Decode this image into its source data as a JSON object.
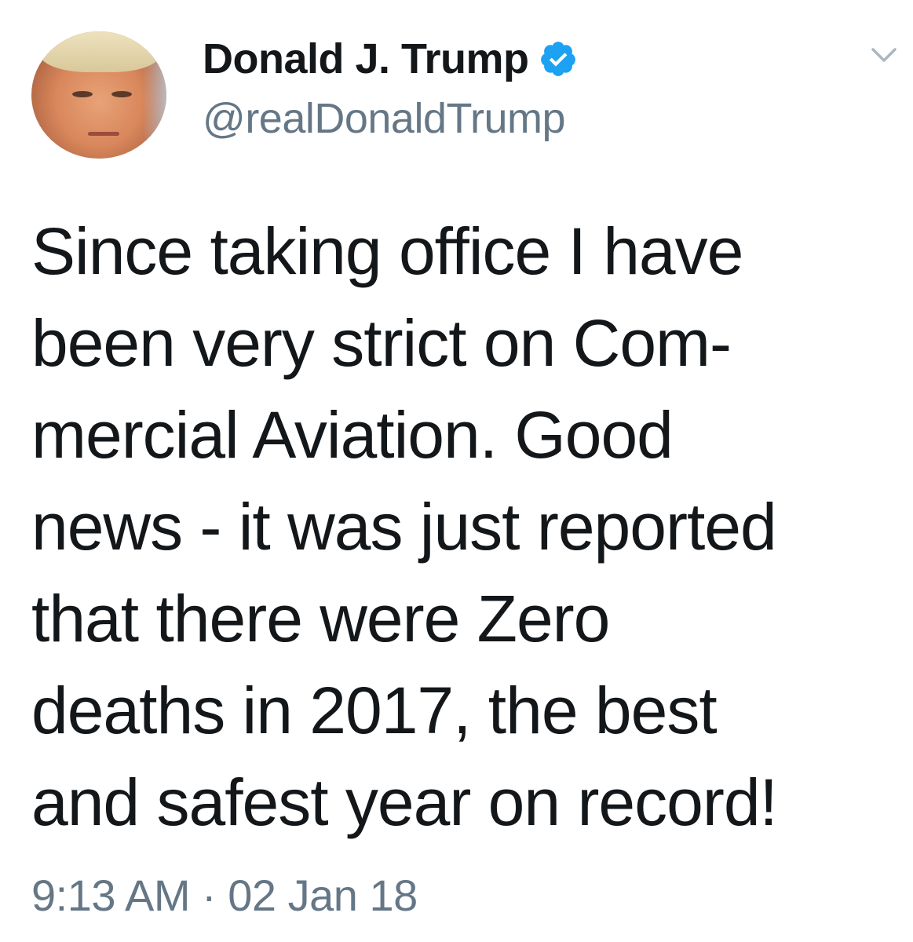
{
  "author": {
    "display_name": "Donald J. Trump",
    "handle": "@realDonaldTrump",
    "verified_icon": "verified-badge-icon",
    "avatar": "profile-photo"
  },
  "tweet": {
    "lines": [
      "Since taking office I have",
      "been very strict on Com-",
      "mercial Aviation. Good",
      "news - it was just reported",
      "that there were Zero",
      "deaths in 2017, the best",
      "and safest year on record!"
    ],
    "time": "9:13 AM",
    "separator": "·",
    "date": "02 Jan 18"
  },
  "icons": {
    "menu": "chevron-down-icon"
  },
  "colors": {
    "text": "#14171a",
    "secondary": "#657786",
    "verified_blue": "#1da1f2",
    "caret": "#aab8c2"
  }
}
